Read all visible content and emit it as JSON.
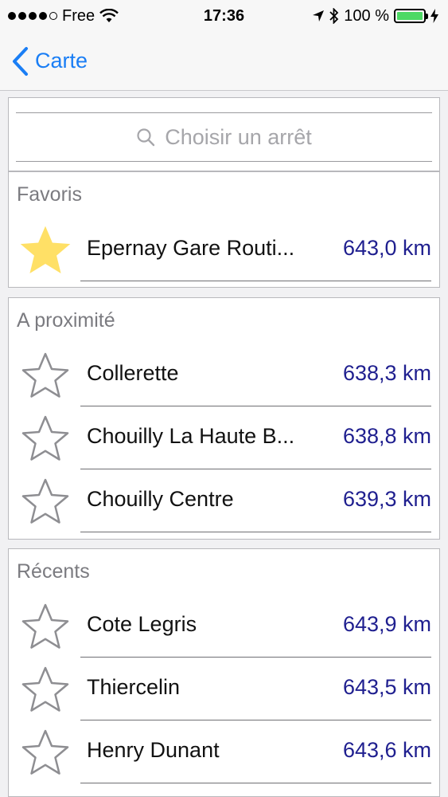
{
  "status_bar": {
    "carrier": "Free",
    "time": "17:36",
    "battery_text": "100 %"
  },
  "nav": {
    "back_label": "Carte"
  },
  "search": {
    "placeholder": "Choisir un arrêt"
  },
  "sections": {
    "favoris": {
      "title": "Favoris",
      "items": [
        {
          "name": "Epernay Gare Routi...",
          "distance": "643,0 km",
          "favorite": true
        }
      ]
    },
    "proximite": {
      "title": "A proximité",
      "items": [
        {
          "name": "Collerette",
          "distance": "638,3 km",
          "favorite": false
        },
        {
          "name": "Chouilly La Haute B...",
          "distance": "638,8 km",
          "favorite": false
        },
        {
          "name": "Chouilly Centre",
          "distance": "639,3 km",
          "favorite": false
        }
      ]
    },
    "recents": {
      "title": "Récents",
      "items": [
        {
          "name": "Cote Legris",
          "distance": "643,9 km",
          "favorite": false
        },
        {
          "name": "Thiercelin",
          "distance": "643,5 km",
          "favorite": false
        },
        {
          "name": "Henry Dunant",
          "distance": "643,6 km",
          "favorite": false
        }
      ]
    }
  },
  "colors": {
    "accent": "#1a7ef5",
    "distance": "#1f1f8f",
    "favorite_star": "#ffe066",
    "battery": "#4cd964"
  }
}
